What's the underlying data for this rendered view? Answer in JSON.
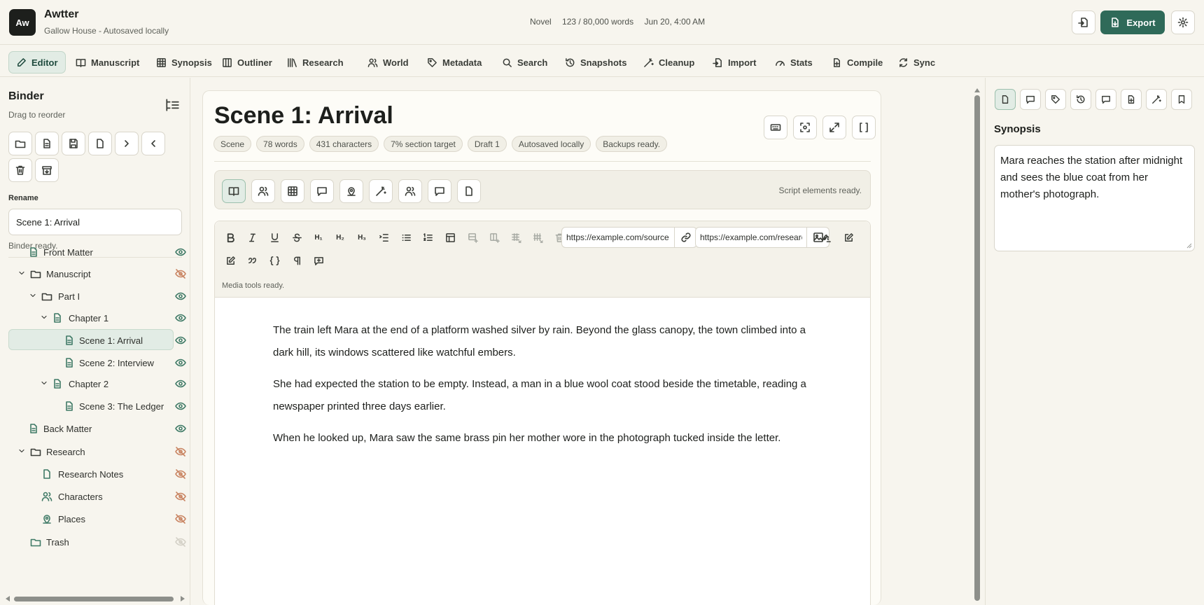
{
  "app": {
    "logo": "Aw",
    "title": "Awtter",
    "subtitle": "Gallow House - Autosaved locally",
    "genre": "Novel",
    "word_count": "123 / 80,000 words",
    "timestamp": "Jun 20, 4:00 AM",
    "export_label": "Export"
  },
  "tabs": [
    {
      "label": "Editor",
      "icon": "pencil-icon",
      "active": true
    },
    {
      "label": "Manuscript",
      "icon": "book-icon"
    },
    {
      "label": "Synopsis",
      "icon": "grid-icon"
    },
    {
      "label": "Outliner",
      "icon": "columns-icon"
    },
    {
      "label": "Research",
      "icon": "library-icon"
    },
    {
      "label": "World",
      "icon": "users-icon"
    },
    {
      "label": "Metadata",
      "icon": "tag-icon"
    },
    {
      "label": "Search",
      "icon": "search-icon"
    },
    {
      "label": "Snapshots",
      "icon": "history-icon"
    },
    {
      "label": "Cleanup",
      "icon": "wand-icon"
    },
    {
      "label": "Import",
      "icon": "import-icon"
    },
    {
      "label": "Stats",
      "icon": "gauge-icon"
    },
    {
      "label": "Compile",
      "icon": "file-plus-icon"
    },
    {
      "label": "Sync",
      "icon": "sync-icon"
    }
  ],
  "binder": {
    "title": "Binder",
    "subtitle": "Drag to reorder",
    "rename_label": "Rename",
    "rename_value": "Scene 1: Arrival",
    "status": "Binder ready.",
    "tree": [
      {
        "label": "Front Matter",
        "type": "doc",
        "depth": 0,
        "visible": true
      },
      {
        "label": "Manuscript",
        "type": "folder",
        "depth": 0,
        "visible": false
      },
      {
        "label": "Part I",
        "type": "folder",
        "depth": 1,
        "visible": true
      },
      {
        "label": "Chapter 1",
        "type": "doc",
        "depth": 2,
        "visible": true
      },
      {
        "label": "Scene 1: Arrival",
        "type": "doc",
        "depth": 3,
        "visible": true,
        "selected": true
      },
      {
        "label": "Scene 2: Interview",
        "type": "doc",
        "depth": 3,
        "visible": true
      },
      {
        "label": "Chapter 2",
        "type": "doc",
        "depth": 2,
        "visible": true
      },
      {
        "label": "Scene 3: The Ledger",
        "type": "doc",
        "depth": 3,
        "visible": true
      },
      {
        "label": "Back Matter",
        "type": "doc",
        "depth": 0,
        "visible": true
      },
      {
        "label": "Research",
        "type": "folder",
        "depth": 0,
        "visible": false
      },
      {
        "label": "Research Notes",
        "type": "doc",
        "depth": 1,
        "visible": false
      },
      {
        "label": "Characters",
        "type": "users",
        "depth": 1,
        "visible": false
      },
      {
        "label": "Places",
        "type": "pin",
        "depth": 1,
        "visible": false
      },
      {
        "label": "Trash",
        "type": "folder",
        "depth": 0,
        "visible": "faint"
      }
    ]
  },
  "editor": {
    "title": "Scene 1: Arrival",
    "chips": [
      "Scene",
      "78 words",
      "431 characters",
      "7% section target",
      "Draft 1",
      "Autosaved locally",
      "Backups ready."
    ],
    "script_status": "Script elements ready.",
    "link_url": "https://example.com/source",
    "image_url": "https://example.com/research",
    "media_status": "Media tools ready.",
    "paragraphs": [
      "The train left Mara at the end of a platform washed silver by rain. Beyond the glass canopy, the town climbed into a dark hill, its windows scattered like watchful embers.",
      "She had expected the station to be empty. Instead, a man in a blue wool coat stood beside the timetable, reading a newspaper printed three days earlier.",
      "When he looked up, Mara saw the same brass pin her mother wore in the photograph tucked inside the letter."
    ]
  },
  "inspector": {
    "title": "Synopsis",
    "synopsis": "Mara reaches the station after midnight and sees the blue coat from her mother's photograph."
  },
  "colors": {
    "accent": "#2f6a59",
    "selected_bg": "#e2ece5",
    "visible_eye": "#3f7a66",
    "hidden_eye": "#c98563"
  }
}
